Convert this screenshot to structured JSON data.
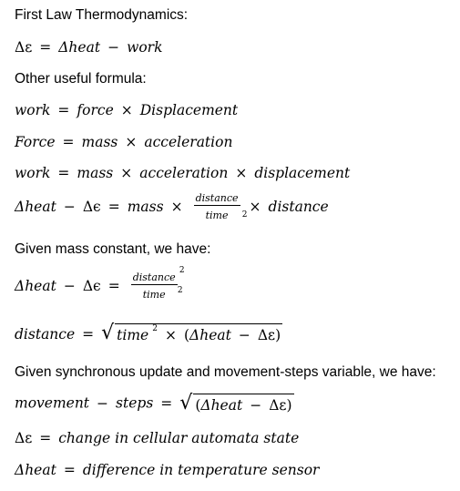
{
  "heading": "First Law Thermodynamics:",
  "eq1": {
    "lhs": "Δε",
    "eq": "=",
    "a": "Δheat",
    "minus": "−",
    "b": "work"
  },
  "other": "Other useful formula:",
  "eq2": {
    "lhs": "work",
    "eq": "=",
    "a": "force",
    "times": "×",
    "b": "Displacement"
  },
  "eq3": {
    "lhs": "Force",
    "eq": "=",
    "a": "mass",
    "times": "×",
    "b": "acceleration"
  },
  "eq4": {
    "lhs": "work",
    "eq": "=",
    "a": "mass",
    "times1": "×",
    "b": "acceleration",
    "times2": "×",
    "c": "displacement"
  },
  "eq5": {
    "a": "Δheat",
    "minus": "−",
    "b": "Δϵ",
    "eq": "=",
    "c": "mass",
    "times1": "×",
    "num": "distance",
    "den": "time",
    "den_exp": "2",
    "times2": "×",
    "d": "distance"
  },
  "given_mass": "Given mass constant, we have:",
  "eq6": {
    "a": "Δheat",
    "minus": "−",
    "b": "Δϵ",
    "eq": "=",
    "num": "distance",
    "num_exp": "2",
    "den": "time",
    "den_exp": "2"
  },
  "eq7": {
    "lhs": "distance",
    "eq": "=",
    "inner_a": "time",
    "exp": "2",
    "times": "×",
    "paren_open": "(",
    "inner_b": "Δheat",
    "minus": "−",
    "inner_c": "Δε",
    "paren_close": ")"
  },
  "given_sync": "Given synchronous update and movement-steps variable, we have:",
  "eq8": {
    "a": "movement",
    "minus1": "−",
    "b": "steps",
    "eq": "=",
    "paren_open": "(",
    "inner_a": "Δheat",
    "minus2": "−",
    "inner_b": "Δε",
    "paren_close": ")"
  },
  "eq9": {
    "lhs": "Δε",
    "eq": "=",
    "rhs": "change in cellular automata state"
  },
  "eq10": {
    "lhs": "Δheat",
    "eq": "=",
    "rhs": "difference in temperature sensor"
  }
}
